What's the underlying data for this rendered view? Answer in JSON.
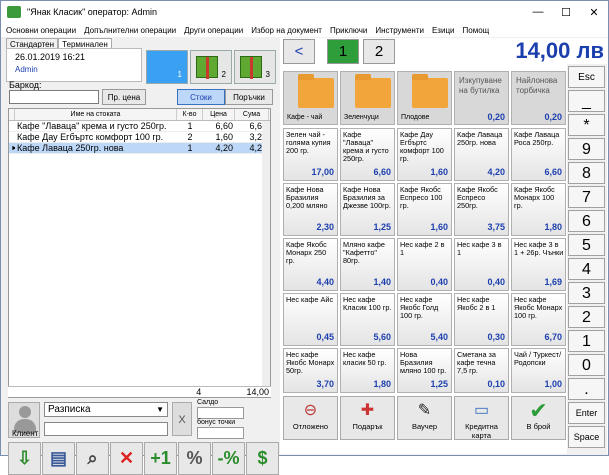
{
  "window": {
    "title": "\"Янак Класик\" оператор: Admin",
    "controls": [
      "—",
      "☐",
      "✕"
    ]
  },
  "menu": [
    "Основни операции",
    "Допълнителни операции",
    "Други операции",
    "Избор на документ",
    "Приключи",
    "Инструменти",
    "Езици",
    "Помощ"
  ],
  "left": {
    "tabs": [
      "Стандартен",
      "Терминален"
    ],
    "datetime": "26.01.2019  16:21",
    "user": "Admin",
    "pages": [
      "1",
      "2",
      "3"
    ],
    "barcode_label": "Баркод:",
    "price_button": "Пр. цена",
    "toggle_goods": "Стоки",
    "toggle_orders": "Поръчки",
    "columns": [
      "Име на стоката",
      "К-во",
      "Цена",
      "Сума"
    ],
    "rows": [
      {
        "name": "Кафе \"Лаваца\" крема и густо 250гр.",
        "qty": "1",
        "price": "6,60",
        "sum": "6,60",
        "selected": false
      },
      {
        "name": "Кафе Дау Егбъртс комфорт 100 гр.",
        "qty": "2",
        "price": "1,60",
        "sum": "3,20",
        "selected": false
      },
      {
        "name": "Кафе Лаваца 250гр. нова",
        "qty": "1",
        "price": "4,20",
        "sum": "4,20",
        "selected": true
      }
    ],
    "total_qty": "4",
    "total_sum": "14,00",
    "doc_type": "Разписка",
    "client_label": "Клиент",
    "saldo_label": "Салдо",
    "bonus_label": "бонус точки",
    "clear_button": "X"
  },
  "right": {
    "page_prev": "<",
    "pages": [
      "1",
      "2"
    ],
    "amount": "14,00 лв",
    "folders": [
      "Кафе - чай",
      "Зеленчуци",
      "Плодове"
    ],
    "specials": [
      {
        "name": "Изкупуване на бутилка",
        "price": "0,20"
      },
      {
        "name": "Найлонова торбичка",
        "price": "0,20"
      }
    ],
    "products": [
      {
        "name": "Зелен чай - голяма купия 200 гр.",
        "price": "17,00"
      },
      {
        "name": "Кафе \"Лаваца\" крема и густо 250гр.",
        "price": "6,60"
      },
      {
        "name": "Кафе Дау Егбъртс комфорт 100 гр.",
        "price": "1,60"
      },
      {
        "name": "Кафе Лаваца 250гр. нова",
        "price": "4,20"
      },
      {
        "name": "Кафе Лаваца Роса 250гр.",
        "price": "6,60"
      },
      {
        "name": "Кафе Нова Бразилия 0,200 мляно",
        "price": "2,30"
      },
      {
        "name": "Кафе Нова Бразилия за Джезве 100гр.",
        "price": "1,25"
      },
      {
        "name": "Кафе Якобс Еспресо 100 гр.",
        "price": "1,60"
      },
      {
        "name": "Кафе Якобс Еспресо 250гр.",
        "price": "3,75"
      },
      {
        "name": "Кафе Якобс Монарх 100 гр.",
        "price": "1,80"
      },
      {
        "name": "Кафе Якобс Монарх 250 гр.",
        "price": "4,40"
      },
      {
        "name": "Мляно кафе \"Кафетто\" 80гр.",
        "price": "1,40"
      },
      {
        "name": "Нес кафе 2 в 1",
        "price": "0,40"
      },
      {
        "name": "Нес кафе 3 в 1",
        "price": "0,40"
      },
      {
        "name": "Нес кафе 3 в 1 + 26р. Чънки",
        "price": "1,69"
      },
      {
        "name": "Нес кафе Айс",
        "price": "0,45"
      },
      {
        "name": "Нес кафе Класик 100 гр.",
        "price": "5,60"
      },
      {
        "name": "Нес кафе Якобс Голд 100 гр.",
        "price": "5,40"
      },
      {
        "name": "Нес кафе Якобс 2 в 1",
        "price": "0,30"
      },
      {
        "name": "Нес кафе Якобс Монарх 100 гр.",
        "price": "6,70"
      },
      {
        "name": "Нес кафе Якобс Монарх 50гр.",
        "price": "3,70"
      },
      {
        "name": "Нес кафе класик 50 гр.",
        "price": "1,80"
      },
      {
        "name": "Нова Бразилия мляно 100 гр.",
        "price": "1,25"
      },
      {
        "name": "Сметана за кафе течна 7,5 гр.",
        "price": "0,10"
      },
      {
        "name": "Чай / Туркест/Родопски",
        "price": "1,00"
      }
    ],
    "actions": [
      "Отложено",
      "Подарък",
      "Ваучер",
      "Кредитна карта",
      "В брой"
    ],
    "keys": [
      "Esc",
      "_",
      "*",
      "9",
      "8",
      "7",
      "6",
      "5",
      "4",
      "3",
      "2",
      "1",
      "0",
      ".",
      "Enter",
      "Space"
    ]
  }
}
